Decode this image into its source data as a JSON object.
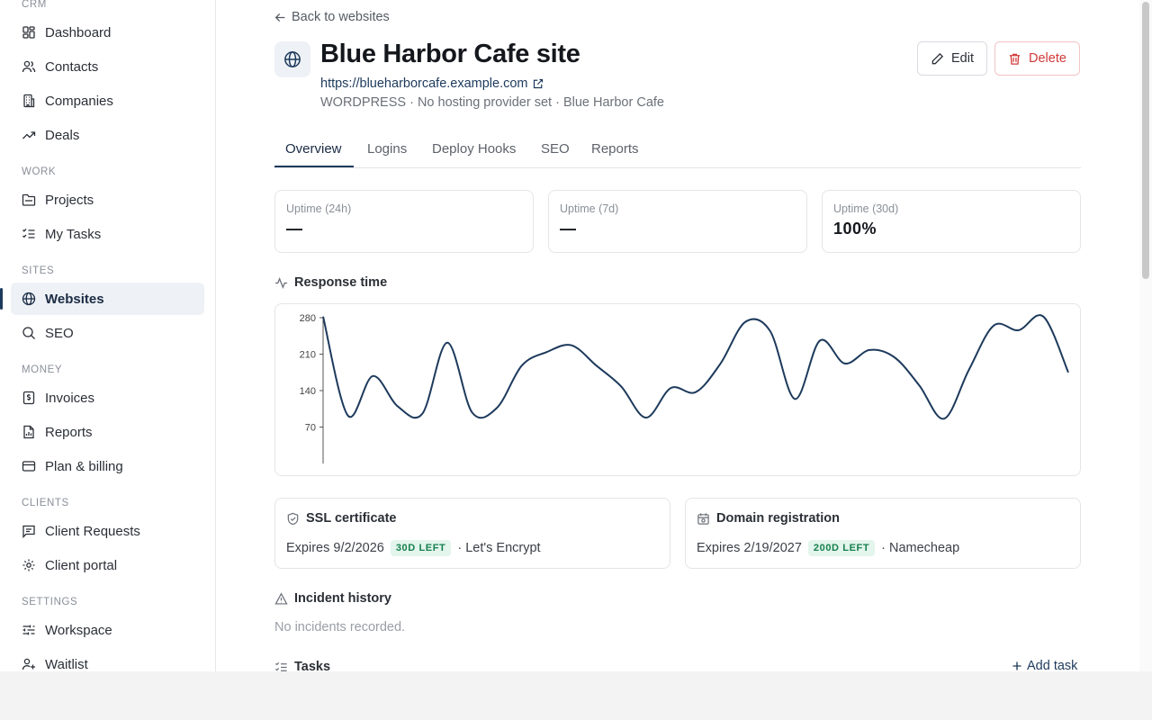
{
  "sidebar": {
    "sections": [
      "CRM",
      "WORK",
      "SITES",
      "MONEY",
      "CLIENTS",
      "SETTINGS"
    ],
    "items": [
      {
        "label": "Dashboard",
        "icon": "dashboard-icon"
      },
      {
        "label": "Contacts",
        "icon": "users-icon"
      },
      {
        "label": "Companies",
        "icon": "building-icon"
      },
      {
        "label": "Deals",
        "icon": "trending-up-icon"
      },
      {
        "label": "Projects",
        "icon": "folder-icon"
      },
      {
        "label": "My Tasks",
        "icon": "list-checks-icon"
      },
      {
        "label": "Websites",
        "icon": "globe-icon",
        "active": true
      },
      {
        "label": "SEO",
        "icon": "search-icon"
      },
      {
        "label": "Invoices",
        "icon": "invoice-icon"
      },
      {
        "label": "Reports",
        "icon": "file-chart-icon"
      },
      {
        "label": "Plan & billing",
        "icon": "credit-card-icon"
      },
      {
        "label": "Client Requests",
        "icon": "message-square-icon"
      },
      {
        "label": "Client portal",
        "icon": "gear-icon"
      },
      {
        "label": "Workspace",
        "icon": "sliders-icon"
      },
      {
        "label": "Waitlist",
        "icon": "user-plus-icon"
      }
    ]
  },
  "header": {
    "back_label": "Back to websites",
    "title": "Blue Harbor Cafe site",
    "url": "https://blueharborcafe.example.com",
    "meta": "WORDPRESS · No hosting provider set · Blue Harbor Cafe",
    "edit_label": "Edit",
    "delete_label": "Delete"
  },
  "tabs": [
    {
      "label": "Overview",
      "active": true
    },
    {
      "label": "Logins"
    },
    {
      "label": "Deploy Hooks"
    },
    {
      "label": "SEO"
    },
    {
      "label": "Reports"
    }
  ],
  "uptime": [
    {
      "label": "Uptime (24h)",
      "value": "—"
    },
    {
      "label": "Uptime (7d)",
      "value": "—"
    },
    {
      "label": "Uptime (30d)",
      "value": "100%"
    }
  ],
  "response_time": {
    "heading": "Response time",
    "chart_data": {
      "type": "line",
      "title": "",
      "xlabel": "",
      "ylabel": "",
      "ylim": [
        0,
        280
      ],
      "yticks": [
        70,
        140,
        210,
        280
      ],
      "grid": false,
      "series": [
        {
          "color": "#1d3a5c",
          "values": [
            282,
            92,
            168,
            110,
            96,
            232,
            98,
            107,
            188,
            214,
            227,
            188,
            148,
            88,
            145,
            137,
            192,
            272,
            254,
            124,
            236,
            192,
            218,
            204,
            150,
            86,
            180,
            265,
            256,
            282,
            175
          ]
        }
      ]
    }
  },
  "ssl": {
    "heading": "SSL certificate",
    "expires": "Expires 9/2/2026",
    "badge": "30D LEFT",
    "provider": "· Let's Encrypt"
  },
  "domain": {
    "heading": "Domain registration",
    "expires": "Expires 2/19/2027",
    "badge": "200D LEFT",
    "provider": "· Namecheap"
  },
  "incidents": {
    "heading": "Incident history",
    "empty": "No incidents recorded."
  },
  "tasks": {
    "heading": "Tasks",
    "add_label": "Add task"
  },
  "colors": {
    "accent": "#1d3a5c",
    "danger": "#d23a3a",
    "badge_bg": "#e3f5ec",
    "badge_text": "#17804e"
  }
}
